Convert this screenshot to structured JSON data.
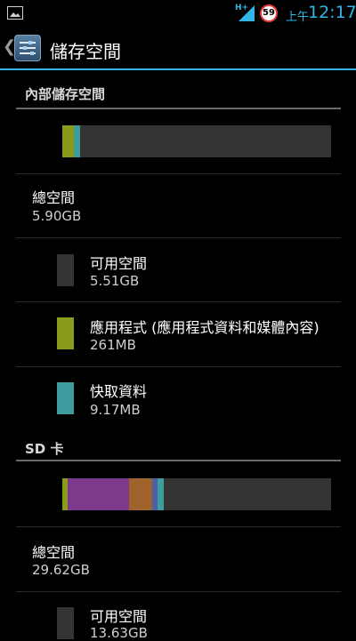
{
  "status": {
    "network": "H+",
    "battery": "59",
    "ampm": "上午",
    "time": "12:17"
  },
  "actionbar": {
    "icon": "settings-sliders-icon",
    "title": "儲存空間"
  },
  "internal": {
    "header": "內部儲存空間",
    "total_label": "總空間",
    "total_value": "5.90GB",
    "items": [
      {
        "label": "可用空間",
        "value": "5.51GB",
        "color": "#333333"
      },
      {
        "label": "應用程式 (應用程式資料和媒體內容)",
        "value": "261MB",
        "color": "#8a9a1b"
      },
      {
        "label": "快取資料",
        "value": "9.17MB",
        "color": "#3d9d9e"
      }
    ],
    "bar": [
      {
        "color": "#8a9a1b",
        "fraction": 0.043
      },
      {
        "color": "#3d9d9e",
        "fraction": 0.024
      }
    ]
  },
  "sd": {
    "header": "SD 卡",
    "total_label": "總空間",
    "total_value": "29.62GB",
    "items": [
      {
        "label": "可用空間",
        "value": "13.63GB",
        "color": "#333333"
      }
    ],
    "bar": [
      {
        "color": "#8a9a1b",
        "fraction": 0.02
      },
      {
        "color": "#7b3a8c",
        "fraction": 0.23
      },
      {
        "color": "#a0622b",
        "fraction": 0.083
      },
      {
        "color": "#4c5fa8",
        "fraction": 0.02
      },
      {
        "color": "#3d9d9e",
        "fraction": 0.023
      }
    ]
  }
}
